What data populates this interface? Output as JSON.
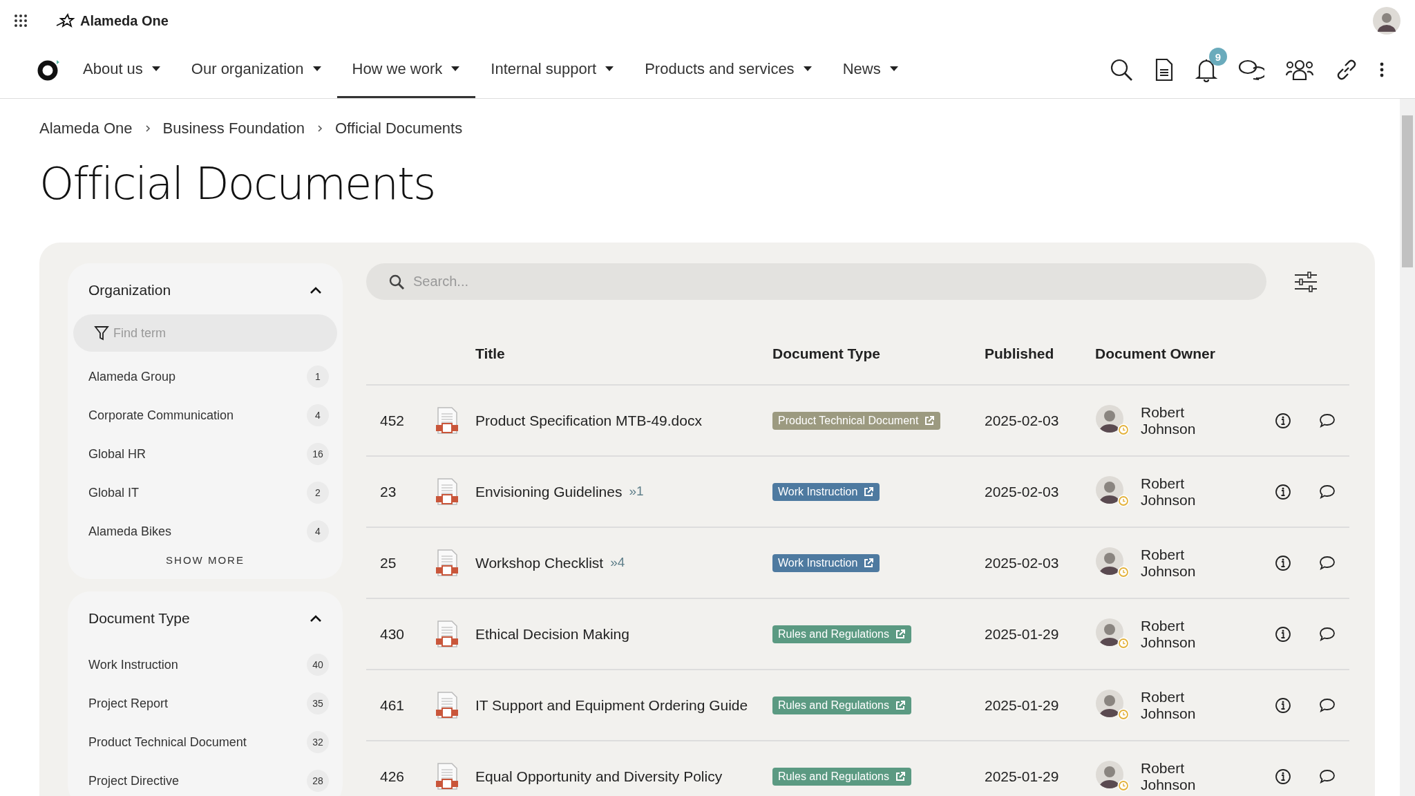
{
  "brand": {
    "name": "Alameda One"
  },
  "nav": [
    {
      "label": "About us",
      "selected": false
    },
    {
      "label": "Our organization",
      "selected": false
    },
    {
      "label": "How we work",
      "selected": true
    },
    {
      "label": "Internal support",
      "selected": false
    },
    {
      "label": "Products and services",
      "selected": false
    },
    {
      "label": "News",
      "selected": false
    }
  ],
  "notifications": {
    "count": "9"
  },
  "breadcrumb": [
    "Alameda One",
    "Business Foundation",
    "Official Documents"
  ],
  "page_title": "Official Documents",
  "filters": [
    {
      "title": "Organization",
      "expanded": true,
      "placeholder": "Find term",
      "items": [
        {
          "label": "Alameda Group",
          "count": "1"
        },
        {
          "label": "Corporate Communication",
          "count": "4"
        },
        {
          "label": "Global HR",
          "count": "16"
        },
        {
          "label": "Global IT",
          "count": "2"
        },
        {
          "label": "Alameda Bikes",
          "count": "4"
        }
      ],
      "more": "SHOW MORE"
    },
    {
      "title": "Document Type",
      "expanded": true,
      "items": [
        {
          "label": "Work Instruction",
          "count": "40"
        },
        {
          "label": "Project Report",
          "count": "35"
        },
        {
          "label": "Product Technical Document",
          "count": "32"
        },
        {
          "label": "Project Directive",
          "count": "28"
        }
      ]
    }
  ],
  "search": {
    "placeholder": "Search..."
  },
  "table": {
    "columns": [
      "Title",
      "Document Type",
      "Published",
      "Document Owner"
    ],
    "rows": [
      {
        "number": "452",
        "title": "Product Specification MTB-49.docx",
        "type": "Product Technical Document",
        "color": "#9c9a80",
        "published": "2025-02-03",
        "owner": "Robert Johnson"
      },
      {
        "number": "23",
        "title": "Envisioning Guidelines",
        "versions": "»1",
        "type": "Work Instruction",
        "color": "#4e7aa0",
        "published": "2025-02-03",
        "owner": "Robert Johnson"
      },
      {
        "number": "25",
        "title": "Workshop Checklist",
        "versions": "»4",
        "type": "Work Instruction",
        "color": "#4e7aa0",
        "published": "2025-02-03",
        "owner": "Robert Johnson"
      },
      {
        "number": "430",
        "title": "Ethical Decision Making",
        "type": "Rules and Regulations",
        "color": "#5b9a82",
        "published": "2025-01-29",
        "owner": "Robert Johnson"
      },
      {
        "number": "461",
        "title": "IT Support and Equipment Ordering Guide",
        "type": "Rules and Regulations",
        "color": "#5b9a82",
        "published": "2025-01-29",
        "owner": "Robert Johnson"
      },
      {
        "number": "426",
        "title": "Equal Opportunity and Diversity Policy",
        "type": "Rules and Regulations",
        "color": "#5b9a82",
        "published": "2025-01-29",
        "owner": "Robert Johnson"
      }
    ]
  }
}
